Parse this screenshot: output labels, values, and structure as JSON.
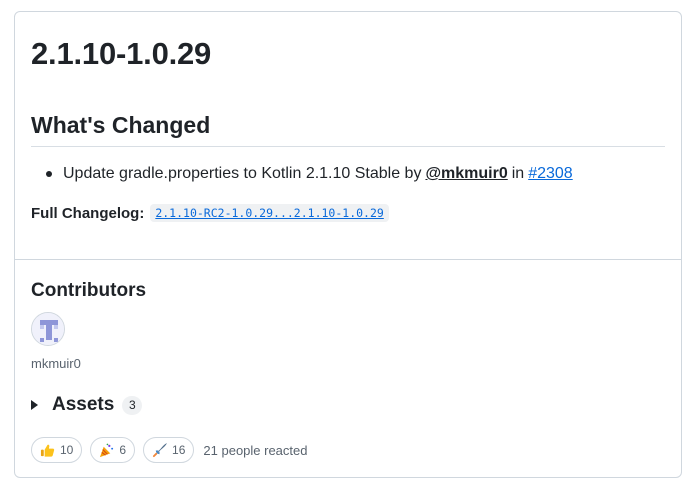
{
  "release": {
    "title": "2.1.10-1.0.29"
  },
  "changes": {
    "heading": "What's Changed",
    "items": [
      {
        "text": "Update gradle.properties to Kotlin 2.1.10 Stable by",
        "author": "@mkmuir0",
        "preposition": "in",
        "link": "#2308"
      }
    ],
    "changelog_label": "Full Changelog:",
    "changelog_value": "2.1.10-RC2-1.0.29...2.1.10-1.0.29"
  },
  "contributors": {
    "heading": "Contributors",
    "names": [
      "mkmuir0"
    ]
  },
  "assets": {
    "label": "Assets",
    "count": "3"
  },
  "reactions": {
    "items": [
      {
        "icon": "thumbs-up-icon",
        "count": "10"
      },
      {
        "icon": "party-popper-icon",
        "count": "6"
      },
      {
        "icon": "rocket-icon",
        "count": "16"
      }
    ],
    "summary": "21 people reacted"
  },
  "colors": {
    "link": "#0969da",
    "border": "#d0d7de",
    "text": "#1f2328",
    "muted": "#59636e"
  }
}
